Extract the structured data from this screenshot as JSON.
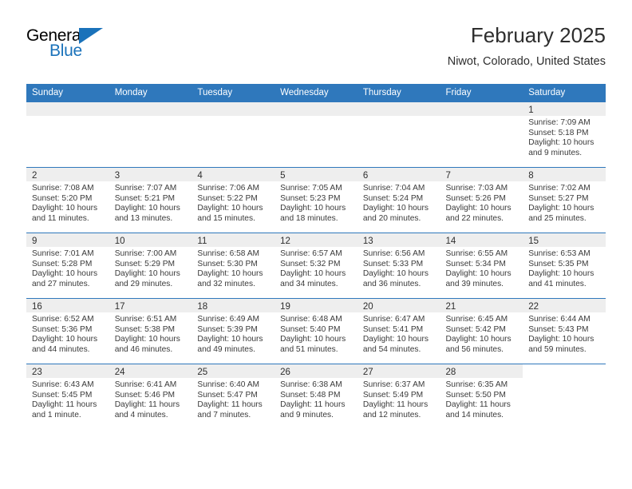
{
  "logo": {
    "line1": "General",
    "line2": "Blue",
    "triangle_color": "#1a72ba"
  },
  "header": {
    "title": "February 2025",
    "subtitle": "Niwot, Colorado, United States"
  },
  "theme": {
    "header_blue": "#2f78bc",
    "shade_gray": "#eeeeee",
    "text": "#2e2e2e"
  },
  "calendar": {
    "weekday_headers": [
      "Sunday",
      "Monday",
      "Tuesday",
      "Wednesday",
      "Thursday",
      "Friday",
      "Saturday"
    ],
    "labels": {
      "sunrise": "Sunrise:",
      "sunset": "Sunset:",
      "daylight": "Daylight:"
    },
    "weeks": [
      [
        {
          "empty": true,
          "shaded": true
        },
        {
          "empty": true,
          "shaded": true
        },
        {
          "empty": true,
          "shaded": true
        },
        {
          "empty": true,
          "shaded": true
        },
        {
          "empty": true,
          "shaded": true
        },
        {
          "empty": true,
          "shaded": true
        },
        {
          "day": "1",
          "sunrise": "Sunrise: 7:09 AM",
          "sunset": "Sunset: 5:18 PM",
          "daylight_l1": "Daylight: 10 hours",
          "daylight_l2": "and 9 minutes."
        }
      ],
      [
        {
          "day": "2",
          "sunrise": "Sunrise: 7:08 AM",
          "sunset": "Sunset: 5:20 PM",
          "daylight_l1": "Daylight: 10 hours",
          "daylight_l2": "and 11 minutes."
        },
        {
          "day": "3",
          "sunrise": "Sunrise: 7:07 AM",
          "sunset": "Sunset: 5:21 PM",
          "daylight_l1": "Daylight: 10 hours",
          "daylight_l2": "and 13 minutes."
        },
        {
          "day": "4",
          "sunrise": "Sunrise: 7:06 AM",
          "sunset": "Sunset: 5:22 PM",
          "daylight_l1": "Daylight: 10 hours",
          "daylight_l2": "and 15 minutes."
        },
        {
          "day": "5",
          "sunrise": "Sunrise: 7:05 AM",
          "sunset": "Sunset: 5:23 PM",
          "daylight_l1": "Daylight: 10 hours",
          "daylight_l2": "and 18 minutes."
        },
        {
          "day": "6",
          "sunrise": "Sunrise: 7:04 AM",
          "sunset": "Sunset: 5:24 PM",
          "daylight_l1": "Daylight: 10 hours",
          "daylight_l2": "and 20 minutes."
        },
        {
          "day": "7",
          "sunrise": "Sunrise: 7:03 AM",
          "sunset": "Sunset: 5:26 PM",
          "daylight_l1": "Daylight: 10 hours",
          "daylight_l2": "and 22 minutes."
        },
        {
          "day": "8",
          "sunrise": "Sunrise: 7:02 AM",
          "sunset": "Sunset: 5:27 PM",
          "daylight_l1": "Daylight: 10 hours",
          "daylight_l2": "and 25 minutes."
        }
      ],
      [
        {
          "day": "9",
          "sunrise": "Sunrise: 7:01 AM",
          "sunset": "Sunset: 5:28 PM",
          "daylight_l1": "Daylight: 10 hours",
          "daylight_l2": "and 27 minutes."
        },
        {
          "day": "10",
          "sunrise": "Sunrise: 7:00 AM",
          "sunset": "Sunset: 5:29 PM",
          "daylight_l1": "Daylight: 10 hours",
          "daylight_l2": "and 29 minutes."
        },
        {
          "day": "11",
          "sunrise": "Sunrise: 6:58 AM",
          "sunset": "Sunset: 5:30 PM",
          "daylight_l1": "Daylight: 10 hours",
          "daylight_l2": "and 32 minutes."
        },
        {
          "day": "12",
          "sunrise": "Sunrise: 6:57 AM",
          "sunset": "Sunset: 5:32 PM",
          "daylight_l1": "Daylight: 10 hours",
          "daylight_l2": "and 34 minutes."
        },
        {
          "day": "13",
          "sunrise": "Sunrise: 6:56 AM",
          "sunset": "Sunset: 5:33 PM",
          "daylight_l1": "Daylight: 10 hours",
          "daylight_l2": "and 36 minutes."
        },
        {
          "day": "14",
          "sunrise": "Sunrise: 6:55 AM",
          "sunset": "Sunset: 5:34 PM",
          "daylight_l1": "Daylight: 10 hours",
          "daylight_l2": "and 39 minutes."
        },
        {
          "day": "15",
          "sunrise": "Sunrise: 6:53 AM",
          "sunset": "Sunset: 5:35 PM",
          "daylight_l1": "Daylight: 10 hours",
          "daylight_l2": "and 41 minutes."
        }
      ],
      [
        {
          "day": "16",
          "sunrise": "Sunrise: 6:52 AM",
          "sunset": "Sunset: 5:36 PM",
          "daylight_l1": "Daylight: 10 hours",
          "daylight_l2": "and 44 minutes."
        },
        {
          "day": "17",
          "sunrise": "Sunrise: 6:51 AM",
          "sunset": "Sunset: 5:38 PM",
          "daylight_l1": "Daylight: 10 hours",
          "daylight_l2": "and 46 minutes."
        },
        {
          "day": "18",
          "sunrise": "Sunrise: 6:49 AM",
          "sunset": "Sunset: 5:39 PM",
          "daylight_l1": "Daylight: 10 hours",
          "daylight_l2": "and 49 minutes."
        },
        {
          "day": "19",
          "sunrise": "Sunrise: 6:48 AM",
          "sunset": "Sunset: 5:40 PM",
          "daylight_l1": "Daylight: 10 hours",
          "daylight_l2": "and 51 minutes."
        },
        {
          "day": "20",
          "sunrise": "Sunrise: 6:47 AM",
          "sunset": "Sunset: 5:41 PM",
          "daylight_l1": "Daylight: 10 hours",
          "daylight_l2": "and 54 minutes."
        },
        {
          "day": "21",
          "sunrise": "Sunrise: 6:45 AM",
          "sunset": "Sunset: 5:42 PM",
          "daylight_l1": "Daylight: 10 hours",
          "daylight_l2": "and 56 minutes."
        },
        {
          "day": "22",
          "sunrise": "Sunrise: 6:44 AM",
          "sunset": "Sunset: 5:43 PM",
          "daylight_l1": "Daylight: 10 hours",
          "daylight_l2": "and 59 minutes."
        }
      ],
      [
        {
          "day": "23",
          "sunrise": "Sunrise: 6:43 AM",
          "sunset": "Sunset: 5:45 PM",
          "daylight_l1": "Daylight: 11 hours",
          "daylight_l2": "and 1 minute."
        },
        {
          "day": "24",
          "sunrise": "Sunrise: 6:41 AM",
          "sunset": "Sunset: 5:46 PM",
          "daylight_l1": "Daylight: 11 hours",
          "daylight_l2": "and 4 minutes."
        },
        {
          "day": "25",
          "sunrise": "Sunrise: 6:40 AM",
          "sunset": "Sunset: 5:47 PM",
          "daylight_l1": "Daylight: 11 hours",
          "daylight_l2": "and 7 minutes."
        },
        {
          "day": "26",
          "sunrise": "Sunrise: 6:38 AM",
          "sunset": "Sunset: 5:48 PM",
          "daylight_l1": "Daylight: 11 hours",
          "daylight_l2": "and 9 minutes."
        },
        {
          "day": "27",
          "sunrise": "Sunrise: 6:37 AM",
          "sunset": "Sunset: 5:49 PM",
          "daylight_l1": "Daylight: 11 hours",
          "daylight_l2": "and 12 minutes."
        },
        {
          "day": "28",
          "sunrise": "Sunrise: 6:35 AM",
          "sunset": "Sunset: 5:50 PM",
          "daylight_l1": "Daylight: 11 hours",
          "daylight_l2": "and 14 minutes."
        },
        {
          "empty": true,
          "shaded": false
        }
      ]
    ]
  }
}
